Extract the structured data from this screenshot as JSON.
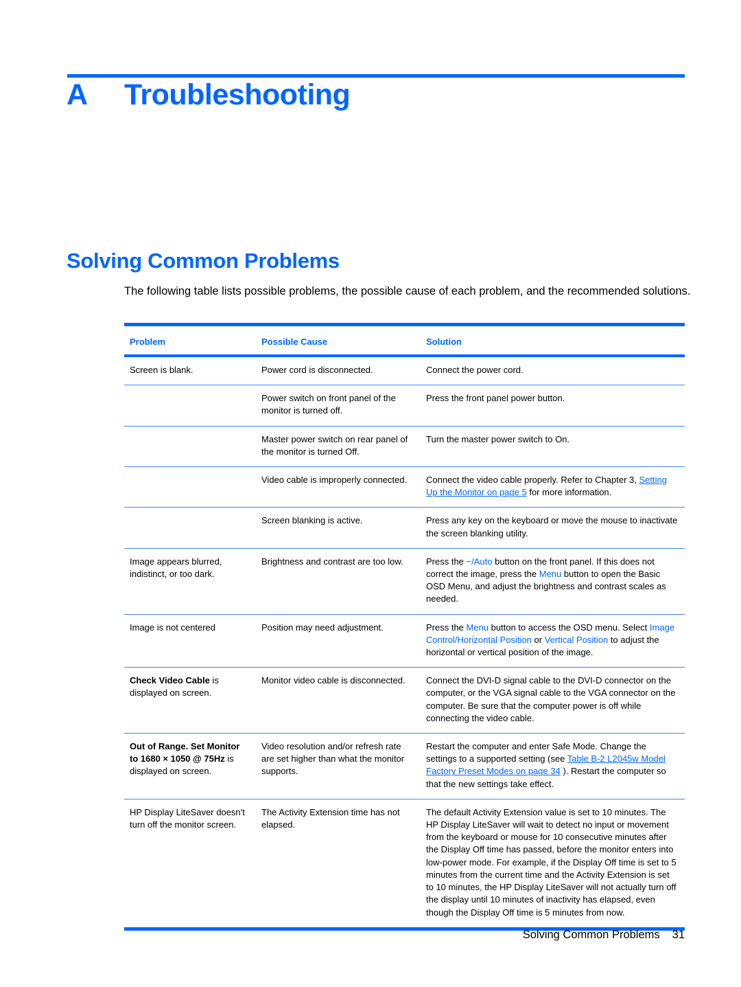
{
  "chapter": {
    "letter": "A",
    "title": "Troubleshooting"
  },
  "section": {
    "title": "Solving Common Problems",
    "intro": "The following table lists possible problems, the possible cause of each problem, and the recommended solutions."
  },
  "colors": {
    "accent": "#0066ff",
    "text": "#000000"
  },
  "table": {
    "headers": [
      "Problem",
      "Possible Cause",
      "Solution"
    ],
    "rows": [
      {
        "problem": [
          {
            "t": "Screen is blank."
          }
        ],
        "cause": "Power cord is disconnected.",
        "solution": [
          {
            "t": "Connect the power cord."
          }
        ]
      },
      {
        "problem": [],
        "cause": "Power switch on front panel of the monitor is turned off.",
        "solution": [
          {
            "t": "Press the front panel power button."
          }
        ]
      },
      {
        "problem": [],
        "cause": "Master power switch on rear panel of the monitor is turned Off.",
        "solution": [
          {
            "t": "Turn the master power switch to On."
          }
        ]
      },
      {
        "problem": [],
        "cause": "Video cable is improperly connected.",
        "solution": [
          {
            "t": "Connect the video cable properly. Refer to Chapter 3, "
          },
          {
            "t": "Setting Up the Monitor on page 5",
            "style": "link"
          },
          {
            "t": " for more information."
          }
        ]
      },
      {
        "problem": [],
        "cause": "Screen blanking is active.",
        "solution": [
          {
            "t": "Press any key on the keyboard or move the mouse to inactivate the screen blanking utility."
          }
        ]
      },
      {
        "problem": [
          {
            "t": "Image appears blurred, indistinct, or too dark."
          }
        ],
        "cause": "Brightness and contrast are too low.",
        "solution": [
          {
            "t": "Press the "
          },
          {
            "t": "−/Auto",
            "style": "blue"
          },
          {
            "t": " button on the front panel. If this does not correct the image, press the "
          },
          {
            "t": "Menu",
            "style": "blue"
          },
          {
            "t": " button to open the Basic OSD Menu, and adjust the brightness and contrast scales as needed."
          }
        ]
      },
      {
        "problem": [
          {
            "t": "Image is not centered"
          }
        ],
        "cause": "Position may need adjustment.",
        "solution": [
          {
            "t": "Press the "
          },
          {
            "t": "Menu",
            "style": "blue"
          },
          {
            "t": " button to access the OSD menu. Select "
          },
          {
            "t": "Image Control/Horizontal Position",
            "style": "blue"
          },
          {
            "t": " or "
          },
          {
            "t": "Vertical Position",
            "style": "blue"
          },
          {
            "t": " to adjust the horizontal or vertical position of the image."
          }
        ]
      },
      {
        "problem": [
          {
            "t": "Check Video Cable",
            "style": "bold"
          },
          {
            "t": " is displayed on screen."
          }
        ],
        "cause": "Monitor video cable is disconnected.",
        "solution": [
          {
            "t": "Connect the DVI-D signal cable to the DVI-D connector on the computer, or the VGA signal cable to the VGA connector on the computer. Be sure that the computer power is off while connecting the video cable."
          }
        ]
      },
      {
        "problem": [
          {
            "t": "Out of Range. Set Monitor to 1680 × 1050 @ 75Hz",
            "style": "bold"
          },
          {
            "t": " is displayed on screen."
          }
        ],
        "cause": "Video resolution and/or refresh rate are set higher than what the monitor supports.",
        "solution": [
          {
            "t": "Restart the computer and enter Safe Mode. Change the settings to a supported setting (see "
          },
          {
            "t": "Table B-2 L2045w Model Factory Preset Modes on page 34",
            "style": "link"
          },
          {
            "t": " ). Restart the computer so that the new settings take effect."
          }
        ]
      },
      {
        "problem": [
          {
            "t": "HP Display LiteSaver doesn't turn off the monitor screen."
          }
        ],
        "cause": "The Activity Extension time has not elapsed.",
        "solution": [
          {
            "t": "The default Activity Extension value is set to 10 minutes. The HP Display LiteSaver will wait to detect no input or movement from the keyboard or mouse for 10 consecutive minutes after the Display Off time has passed, before the monitor enters into low-power mode. For example, if the Display Off time is set to 5 minutes from the current time and the Activity Extension is set to 10 minutes, the HP Display LiteSaver will not actually turn off the display until 10 minutes of inactivity has elapsed, even though the Display Off time is 5 minutes from now."
          }
        ]
      }
    ]
  },
  "footer": {
    "section": "Solving Common Problems",
    "page": "31"
  }
}
